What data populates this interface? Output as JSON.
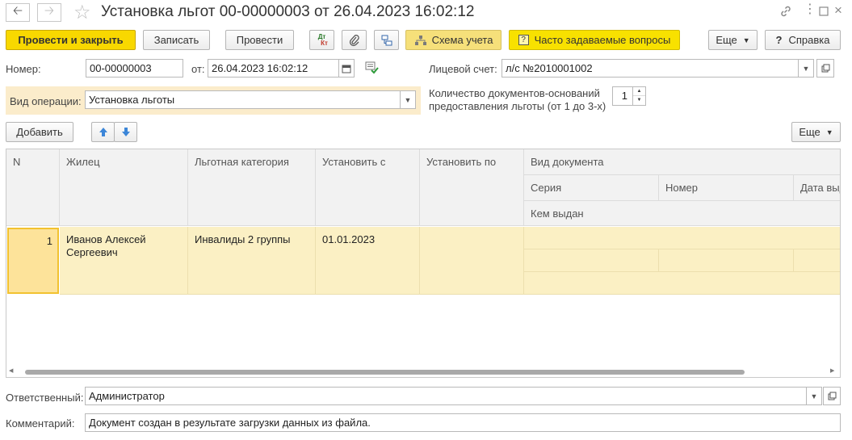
{
  "window": {
    "title": "Установка льгот 00-00000003 от 26.04.2023 16:02:12"
  },
  "toolbar": {
    "post_close": "Провести и закрыть",
    "save": "Записать",
    "post": "Провести",
    "dt_kt_top": "Дт",
    "dt_kt_bottom": "Кт",
    "scheme": "Схема учета",
    "faq": "Часто задаваемые вопросы",
    "more": "Еще",
    "help": "Справка"
  },
  "form": {
    "number_label": "Номер:",
    "number_value": "00-00000003",
    "date_label": "от:",
    "date_value": "26.04.2023 16:02:12",
    "account_label": "Лицевой счет:",
    "account_value": "л/с №2010001002",
    "operation_label": "Вид операции:",
    "operation_value": "Установка льготы",
    "doc_count_label_1": "Количество документов-оснований",
    "doc_count_label_2": "предоставления льготы (от 1 до 3-х)",
    "doc_count_value": "1"
  },
  "table_toolbar": {
    "add": "Добавить",
    "more": "Еще"
  },
  "table": {
    "headers": {
      "n": "N",
      "resident": "Жилец",
      "category": "Льготная категория",
      "from": "Установить с",
      "to": "Установить по",
      "doc_type": "Вид документа",
      "series": "Серия",
      "number": "Номер",
      "issue_date": "Дата выд",
      "issued_by": "Кем выдан"
    },
    "rows": [
      {
        "n": "1",
        "resident": "Иванов Алексей Сергеевич",
        "category": "Инвалиды 2 группы",
        "from": "01.01.2023",
        "to": "",
        "doc_type": "",
        "series": "",
        "number": "",
        "issue_date": "",
        "issued_by": ""
      }
    ]
  },
  "footer": {
    "responsible_label": "Ответственный:",
    "responsible_value": "Администратор",
    "comment_label": "Комментарий:",
    "comment_value": "Документ создан в результате загрузки данных из файла."
  },
  "colors": {
    "primary_button": "#f8d800",
    "accent_button": "#f8e41a",
    "operation_highlight": "#fbeccb",
    "selected_row": "#fbf0c4",
    "selected_cell": "#fde39a",
    "nav_arrow_blue": "#3c86d8"
  }
}
